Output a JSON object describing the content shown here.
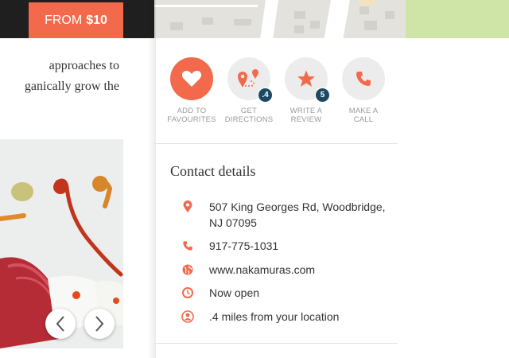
{
  "promo": {
    "price_prefix": "FROM",
    "price_value": "$10"
  },
  "article": {
    "lines": [
      "approaches to",
      "ganically grow the"
    ]
  },
  "gallery": {
    "prev_label": "‹",
    "next_label": "›"
  },
  "actions": [
    {
      "icon": "heart-icon",
      "label_line1": "ADD TO",
      "label_line2": "FAVOURITES",
      "active": true,
      "badge": ""
    },
    {
      "icon": "directions-icon",
      "label_line1": "GET",
      "label_line2": "DIRECTIONS",
      "active": false,
      "badge": ".4"
    },
    {
      "icon": "star-icon",
      "label_line1": "WRITE A",
      "label_line2": "REVIEW",
      "active": false,
      "badge": "5"
    },
    {
      "icon": "phone-icon",
      "label_line1": "MAKE A",
      "label_line2": "CALL",
      "active": false,
      "badge": ""
    }
  ],
  "contact": {
    "title": "Contact details",
    "address": "507 King Georges Rd, Woodbridge, NJ 07095",
    "phone": "917-775-1031",
    "website": "www.nakamuras.com",
    "hours": "Now open",
    "distance": ".4 miles from your location"
  },
  "colors": {
    "accent": "#f26a4b",
    "badge": "#1d4a63",
    "dark_bar": "#1f1f1f"
  }
}
